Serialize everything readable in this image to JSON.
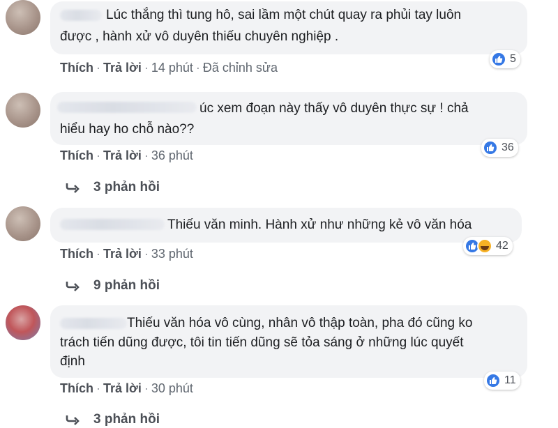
{
  "comments": [
    {
      "text_lines": [
        "Lúc thắng thì tung hô, sai lầm một chút quay ra phủi tay luôn",
        "được , hành xử vô duyên thiếu chuyên nghiệp ."
      ],
      "like_label": "Thích",
      "reply_label": "Trả lời",
      "time": "14 phút",
      "edited": "Đã chỉnh sửa",
      "reaction_count": "5"
    },
    {
      "text_lines": [
        "úc xem đoạn này thấy vô duyên thực sự ! chả",
        "hiểu hay ho chỗ nào??"
      ],
      "like_label": "Thích",
      "reply_label": "Trả lời",
      "time": "36 phút",
      "reaction_count": "36",
      "replies": "3 phản hồi"
    },
    {
      "text_lines": [
        "Thiếu văn minh. Hành xử như những kẻ vô văn hóa"
      ],
      "like_label": "Thích",
      "reply_label": "Trả lời",
      "time": "33 phút",
      "reaction_count": "42",
      "replies": "9 phản hồi"
    },
    {
      "text_lines": [
        "Thiếu văn hóa vô cùng, nhân vô thập toàn, pha đó cũng ko",
        "trách tiến dũng được, tôi tin tiến dũng sẽ tỏa sáng ở những lúc quyết",
        "định"
      ],
      "like_label": "Thích",
      "reply_label": "Trả lời",
      "time": "30 phút",
      "reaction_count": "11",
      "replies": "3 phản hồi"
    }
  ],
  "colors": {
    "bubble": "#f2f3f5",
    "meta": "#606770",
    "like_blue": "#3578e5",
    "haha_yellow": "#f7b125"
  }
}
